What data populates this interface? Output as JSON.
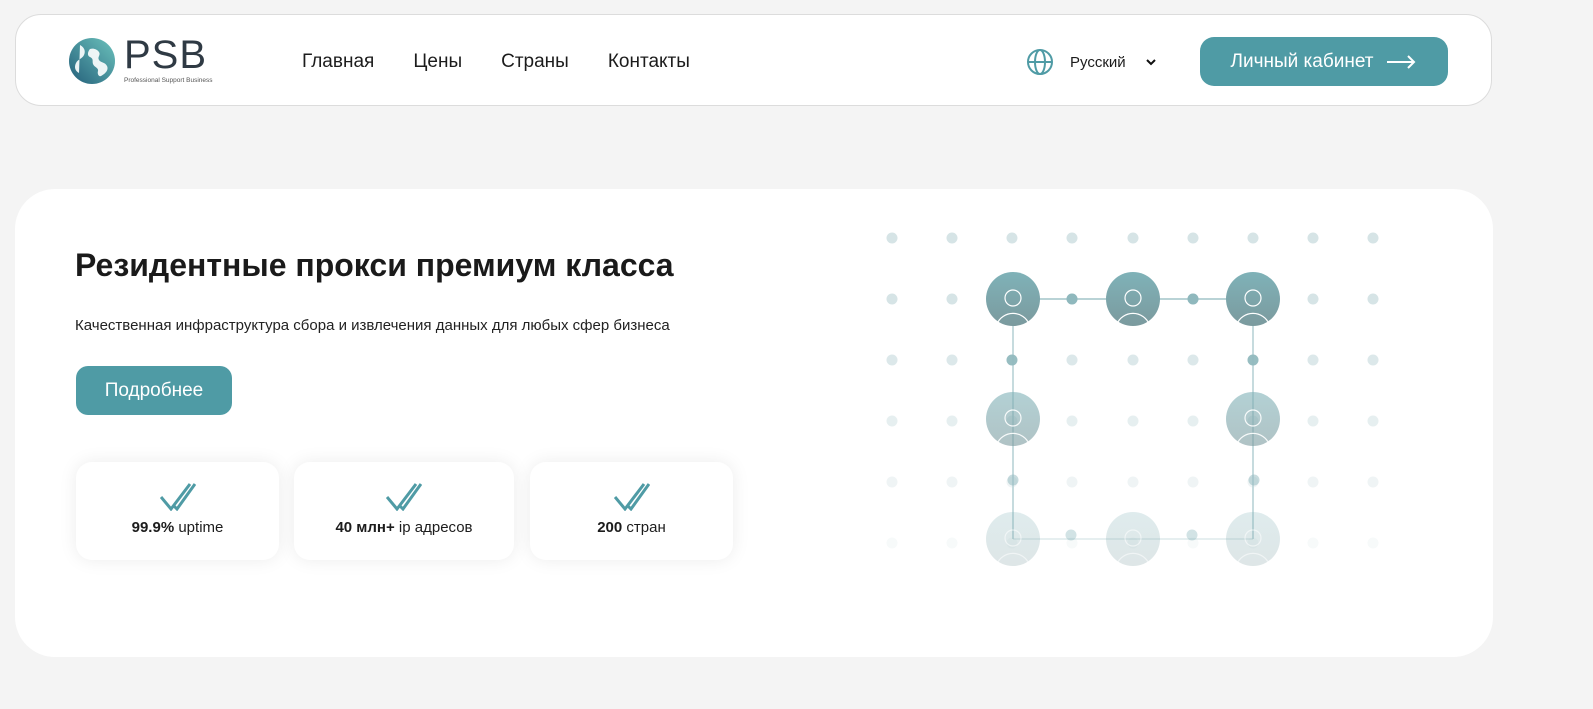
{
  "header": {
    "logo": {
      "word": "PSB",
      "tagline": "Professional Support Business"
    },
    "nav": [
      "Главная",
      "Цены",
      "Страны",
      "Контакты"
    ],
    "language": {
      "icon": "globe-icon",
      "label": "Русский"
    },
    "cabinet_button": "Личный кабинет"
  },
  "hero": {
    "title": "Резидентные прокси премиум класса",
    "subtitle": "Качественная инфраструктура сбора и извлечения данных для любых сфер бизнеса",
    "more_button": "Подробнее",
    "stats": [
      {
        "value": "99.9%",
        "label": "uptime"
      },
      {
        "value": "40 млн+",
        "label": "ip адресов"
      },
      {
        "value": "200",
        "label": "стран"
      }
    ]
  },
  "colors": {
    "accent": "#4f9ba5",
    "background": "#f4f4f4"
  }
}
